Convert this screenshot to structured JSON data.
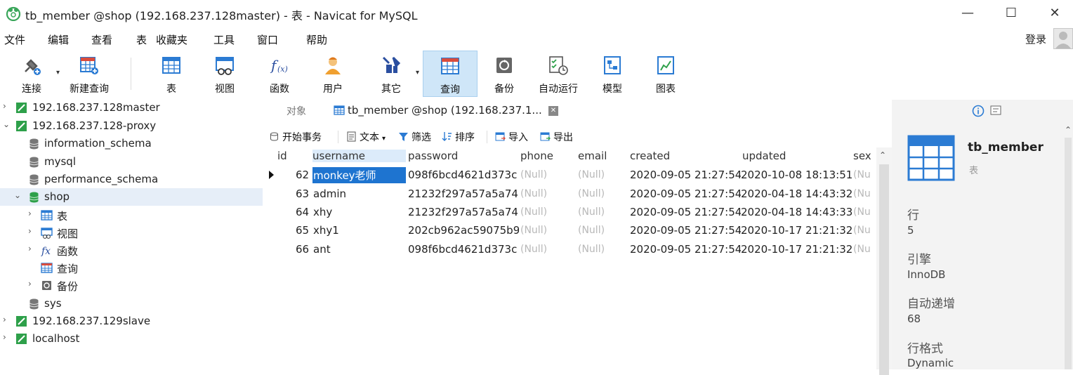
{
  "window": {
    "title": "tb_member @shop (192.168.237.128master) - 表 - Navicat for MySQL",
    "minimize": "—",
    "maximize": "☐",
    "close": "✕"
  },
  "menu": {
    "items": [
      "文件",
      "编辑",
      "查看",
      "表",
      "收藏夹",
      "工具",
      "窗口",
      "帮助"
    ],
    "login": "登录"
  },
  "toolbar": {
    "items": [
      {
        "label": "连接",
        "icon": "connection-icon"
      },
      {
        "label": "新建查询",
        "icon": "new-query-icon"
      },
      {
        "label": "表",
        "icon": "table-icon"
      },
      {
        "label": "视图",
        "icon": "view-icon"
      },
      {
        "label": "函数",
        "icon": "function-icon"
      },
      {
        "label": "用户",
        "icon": "user-icon"
      },
      {
        "label": "其它",
        "icon": "other-icon"
      },
      {
        "label": "查询",
        "icon": "query-icon"
      },
      {
        "label": "备份",
        "icon": "backup-icon"
      },
      {
        "label": "自动运行",
        "icon": "auto-run-icon"
      },
      {
        "label": "模型",
        "icon": "model-icon"
      },
      {
        "label": "图表",
        "icon": "chart-icon"
      }
    ],
    "active": "查询"
  },
  "tree": {
    "items": [
      {
        "label": "192.168.237.128master",
        "level": 0,
        "arrow": "›",
        "icon": "connection-icon"
      },
      {
        "label": "192.168.237.128-proxy",
        "level": 0,
        "arrow": "⌄",
        "icon": "connection-icon"
      },
      {
        "label": "information_schema",
        "level": 1,
        "arrow": "",
        "icon": "database-icon"
      },
      {
        "label": "mysql",
        "level": 1,
        "arrow": "",
        "icon": "database-icon"
      },
      {
        "label": "performance_schema",
        "level": 1,
        "arrow": "",
        "icon": "database-icon"
      },
      {
        "label": "shop",
        "level": 1,
        "arrow": "⌄",
        "icon": "database-open-icon"
      },
      {
        "label": "表",
        "level": 2,
        "arrow": "›",
        "icon": "table-icon"
      },
      {
        "label": "视图",
        "level": 2,
        "arrow": "›",
        "icon": "view-icon"
      },
      {
        "label": "函数",
        "level": 2,
        "arrow": "›",
        "icon": "function-icon"
      },
      {
        "label": "查询",
        "level": 2,
        "arrow": "",
        "icon": "query-icon"
      },
      {
        "label": "备份",
        "level": 2,
        "arrow": "›",
        "icon": "backup-icon"
      },
      {
        "label": "sys",
        "level": 1,
        "arrow": "",
        "icon": "database-icon"
      },
      {
        "label": "192.168.237.129slave",
        "level": 0,
        "arrow": "›",
        "icon": "connection-icon"
      },
      {
        "label": "localhost",
        "level": 0,
        "arrow": "›",
        "icon": "connection-icon"
      }
    ],
    "selected": "shop"
  },
  "tabs": {
    "objects": "对象",
    "table_tab": "tb_member @shop (192.168.237.1..."
  },
  "subtoolbar": {
    "begin_transaction": "开始事务",
    "text": "文本",
    "filter": "筛选",
    "sort": "排序",
    "import": "导入",
    "export": "导出"
  },
  "grid": {
    "columns": [
      "id",
      "username",
      "password",
      "phone",
      "email",
      "created",
      "updated",
      "sex"
    ],
    "rows": [
      [
        "62",
        "monkey老师",
        "098f6bcd4621d373c",
        "(Null)",
        "(Null)",
        "2020-09-05 21:27:54",
        "2020-10-08 18:13:51",
        "(Nu"
      ],
      [
        "63",
        "admin",
        "21232f297a57a5a74.",
        "(Null)",
        "(Null)",
        "2020-09-05 21:27:54",
        "2020-04-18 14:43:32",
        "(Nu"
      ],
      [
        "64",
        "xhy",
        "21232f297a57a5a74.",
        "(Null)",
        "(Null)",
        "2020-09-05 21:27:54",
        "2020-04-18 14:43:33",
        "(Nu"
      ],
      [
        "65",
        "xhy1",
        "202cb962ac59075b9",
        "(Null)",
        "(Null)",
        "2020-09-05 21:27:54",
        "2020-10-17 21:21:32",
        "(Nu"
      ],
      [
        "66",
        "ant",
        "098f6bcd4621d373c",
        "(Null)",
        "(Null)",
        "2020-09-05 21:27:54",
        "2020-10-17 21:21:32",
        "(Nu"
      ]
    ]
  },
  "info": {
    "name": "tb_member",
    "type": "表",
    "rows_label": "行",
    "rows_value": "5",
    "engine_label": "引擎",
    "engine_value": "InnoDB",
    "autoinc_label": "自动递增",
    "autoinc_value": "68",
    "rowformat_label": "行格式",
    "rowformat_value": "Dynamic"
  },
  "colors": {
    "accent": "#1e74d0",
    "active_tool": "#cfe6f8",
    "panel_bg": "#f3f3f3",
    "navicat_green": "#3aa65a"
  }
}
